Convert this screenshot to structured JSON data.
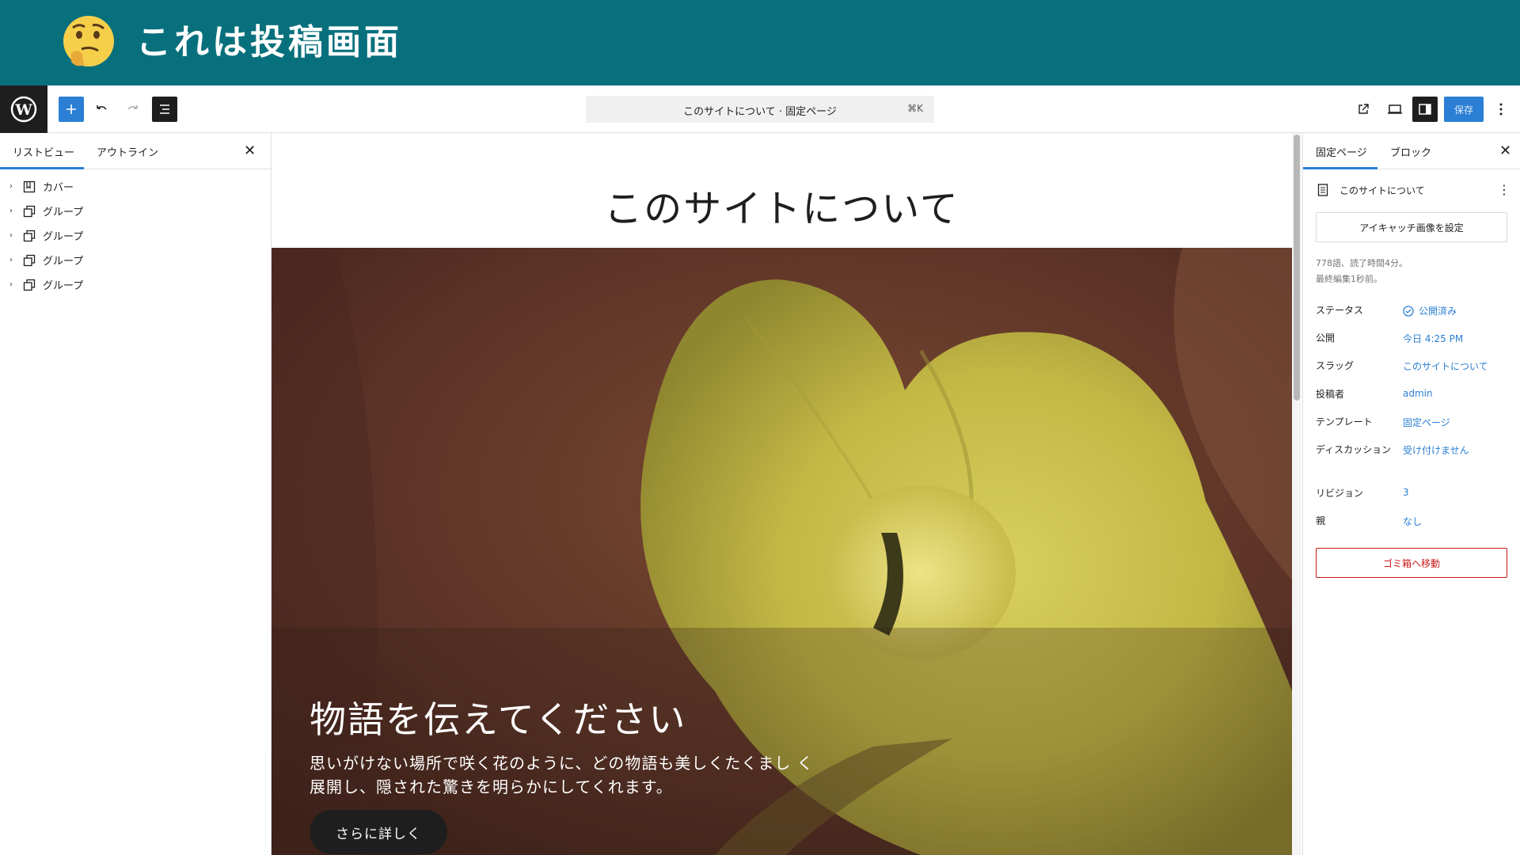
{
  "banner": {
    "title": "これは投稿画面",
    "emoji_icon": "thinking-face-icon"
  },
  "toolbar": {
    "add_icon": "plus-icon",
    "undo_icon": "undo-icon",
    "redo_icon": "redo-icon",
    "list_view_icon": "list-view-icon",
    "command_text": "このサイトについて · 固定ページ",
    "shortcut": "⌘K",
    "view_icon": "external-link-icon",
    "preview_icon": "desktop-icon",
    "settings_icon": "sidebar-icon",
    "save_label": "保存",
    "options_icon": "more-vertical-icon"
  },
  "left_panel": {
    "tabs": [
      {
        "label": "リストビュー"
      },
      {
        "label": "アウトライン"
      }
    ],
    "items": [
      {
        "label": "カバー",
        "icon": "cover-icon"
      },
      {
        "label": "グループ",
        "icon": "group-icon"
      },
      {
        "label": "グループ",
        "icon": "group-icon"
      },
      {
        "label": "グループ",
        "icon": "group-icon"
      },
      {
        "label": "グループ",
        "icon": "group-icon"
      }
    ]
  },
  "canvas": {
    "title": "このサイトについて",
    "cover_heading": "物語を伝えてください",
    "cover_text": "思いがけない場所で咲く花のように、どの物語も美しくたくまし く展開し、隠された驚きを明らかにしてくれます。",
    "cover_button": "さらに詳しく"
  },
  "right_panel": {
    "tabs": [
      {
        "label": "固定ページ"
      },
      {
        "label": "ブロック"
      }
    ],
    "doc_title": "このサイトについて",
    "featured_image_label": "アイキャッチ画像を設定",
    "meta_words": "778語、読了時間4分。",
    "meta_edited": "最終編集1秒前。",
    "properties": [
      {
        "label": "ステータス",
        "value": "公開済み"
      },
      {
        "label": "公開",
        "value": "今日 4:25 PM"
      },
      {
        "label": "スラッグ",
        "value": "このサイトについて"
      },
      {
        "label": "投稿者",
        "value": "admin"
      },
      {
        "label": "テンプレート",
        "value": "固定ページ"
      },
      {
        "label": "ディスカッション",
        "value": "受け付けません"
      },
      {
        "label": "リビジョン",
        "value": "3"
      },
      {
        "label": "親",
        "value": "なし"
      }
    ],
    "trash_label": "ゴミ箱へ移動"
  },
  "colors": {
    "banner": "#08707c",
    "accent": "#2b7fd4",
    "danger": "#cc1818"
  }
}
